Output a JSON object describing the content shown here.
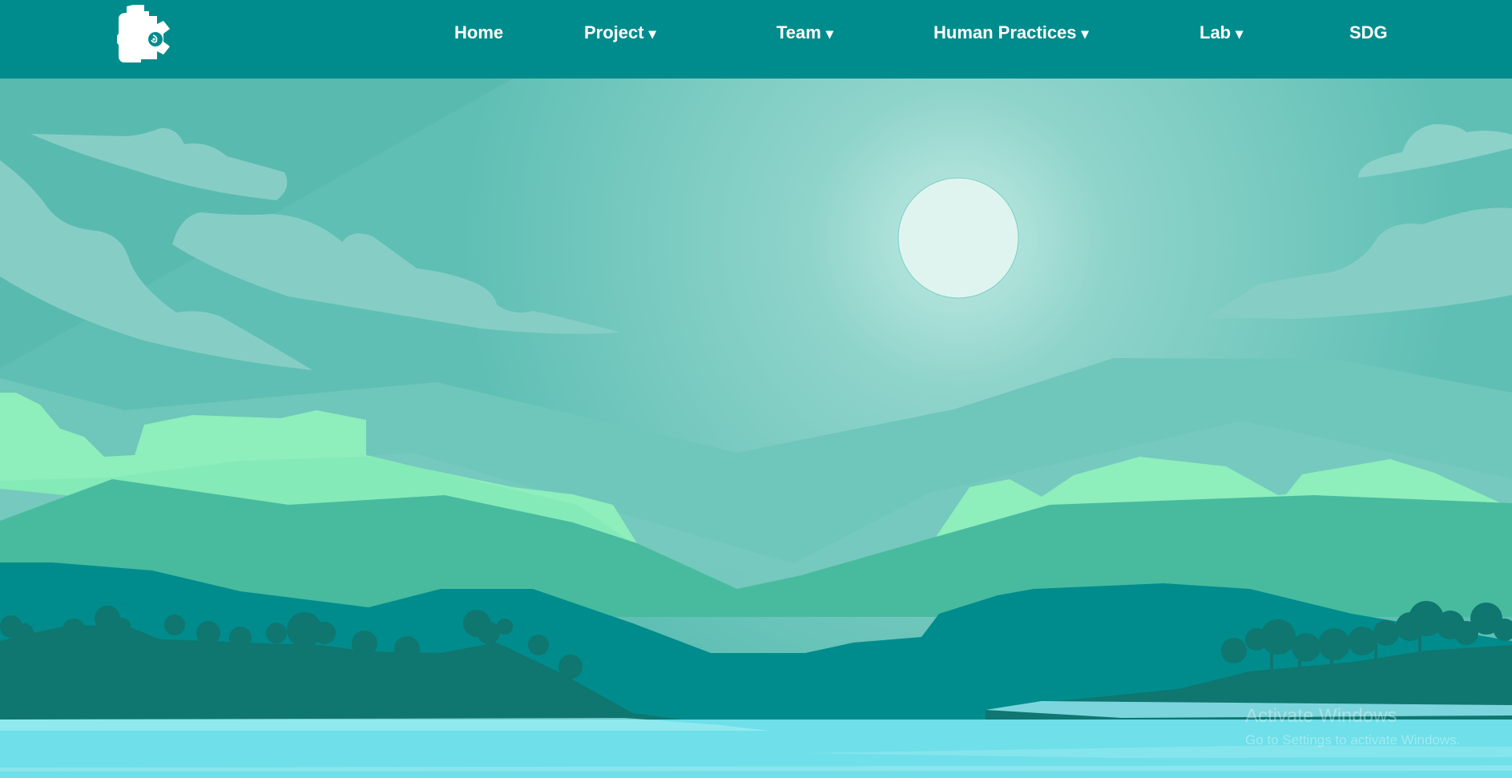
{
  "colors": {
    "navbar": "#008c8c",
    "sky": "#5fbfb4",
    "moon": "#e0f4ef",
    "light_mint": "#8eeebc",
    "mid_green": "#48bb9e",
    "dark_teal": "#008c8c",
    "hill_dark": "#0f7670",
    "water": "#6fdfe9"
  },
  "header": {
    "logo_icon": "gear-puzzle-logo-icon",
    "nav": [
      {
        "label": "Home",
        "has_dropdown": false
      },
      {
        "label": "Project",
        "has_dropdown": true
      },
      {
        "label": "Team",
        "has_dropdown": true
      },
      {
        "label": "Human Practices",
        "has_dropdown": true
      },
      {
        "label": "Lab",
        "has_dropdown": true
      },
      {
        "label": "SDG",
        "has_dropdown": false
      }
    ],
    "dropdown_glyph": "▾"
  },
  "watermark": {
    "title": "Activate Windows",
    "subtitle": "Go to Settings to activate Windows."
  }
}
